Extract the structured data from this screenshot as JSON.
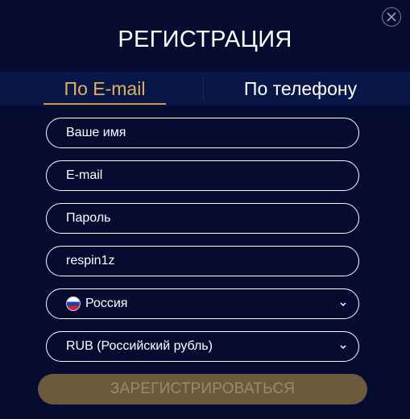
{
  "modal": {
    "title": "РЕГИСТРАЦИЯ",
    "close_icon": "close-icon"
  },
  "tabs": [
    {
      "label": "По E-mail",
      "active": true
    },
    {
      "label": "По телефону",
      "active": false
    }
  ],
  "form": {
    "name_placeholder": "Ваше имя",
    "email_placeholder": "E-mail",
    "password_placeholder": "Пароль",
    "promo_value": "respin1z",
    "country": {
      "value": "Россия",
      "icon": "russia-flag-icon"
    },
    "currency": {
      "value": "RUB (Российский рубль)"
    },
    "submit_label": "ЗАРЕГИСТРИРОВАТЬСЯ"
  },
  "colors": {
    "background": "#060b30",
    "tabbar": "#091748",
    "accent_gold": "#e0b060",
    "button_disabled": "#6b5a3c"
  }
}
